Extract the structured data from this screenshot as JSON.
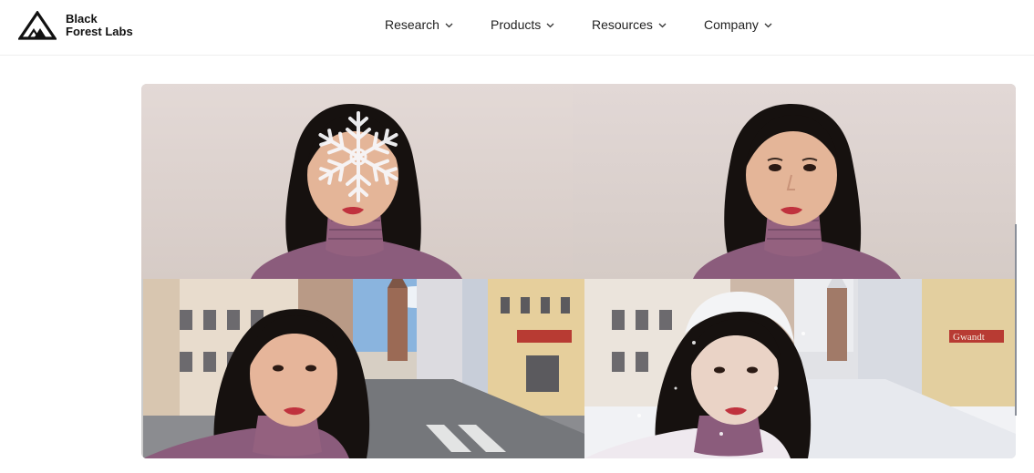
{
  "brand": {
    "line1": "Black",
    "line2": "Forest Labs",
    "icon": "triangle-logo-icon"
  },
  "nav": {
    "items": [
      {
        "label": "Research",
        "icon": "chevron-down-icon"
      },
      {
        "label": "Products",
        "icon": "chevron-down-icon"
      },
      {
        "label": "Resources",
        "icon": "chevron-down-icon"
      },
      {
        "label": "Company",
        "icon": "chevron-down-icon"
      }
    ]
  },
  "gallery": {
    "sign_text": "Gwandt",
    "colors": {
      "wall": "#e2d7d3",
      "sweater": "#8b5c7c",
      "hair": "#16110f",
      "skin": "#e2b296",
      "lips": "#c0323e",
      "snow": "#f1f2f5",
      "sky": "#8ab4de",
      "road": "#75777b"
    }
  }
}
